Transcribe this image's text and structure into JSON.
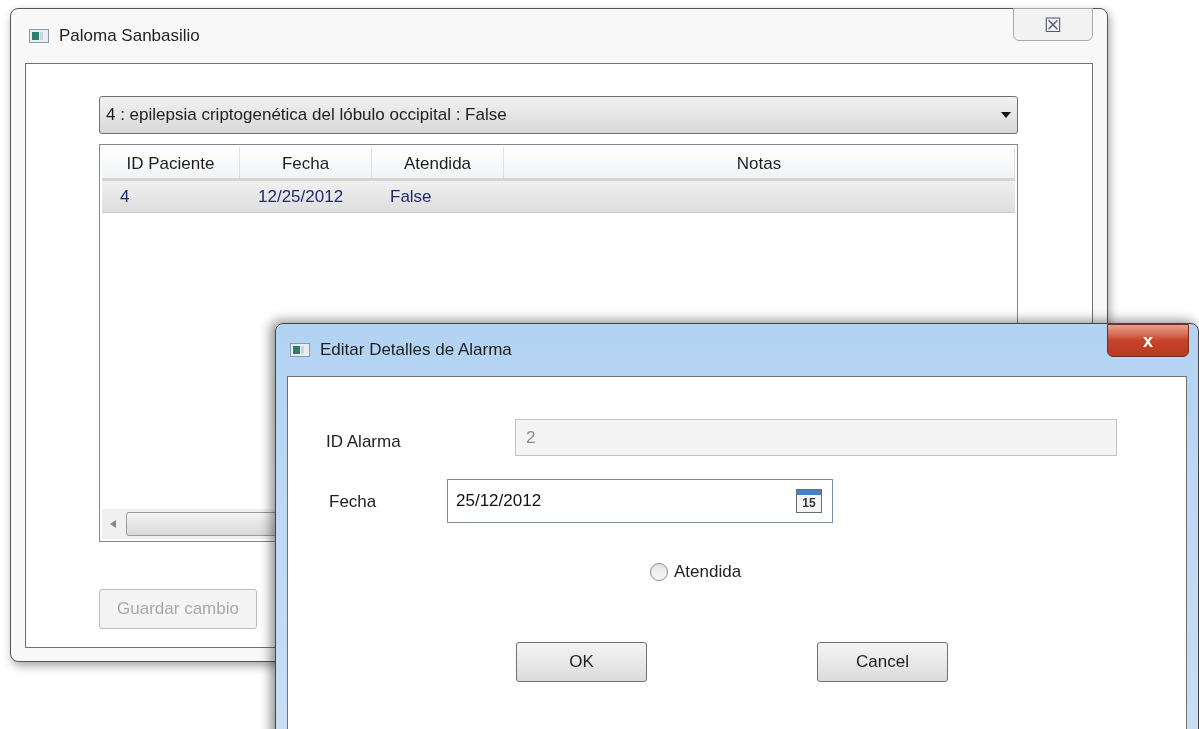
{
  "main_window": {
    "title": "Paloma Sanbasilio",
    "close_glyph": "☒",
    "combobox": {
      "value": "4 : epilepsia criptogenética del lóbulo occipital : False"
    },
    "table": {
      "columns": [
        "ID Paciente",
        "Fecha",
        "Atendida",
        "Notas"
      ],
      "rows": [
        {
          "cells": [
            "4",
            "12/25/2012",
            "False",
            ""
          ],
          "selected": true
        }
      ]
    },
    "save_button": {
      "label": "Guardar cambio",
      "disabled": true
    }
  },
  "dialog": {
    "title": "Editar Detalles de Alarma",
    "close_glyph": "x",
    "fields": [
      {
        "label": "ID Alarma",
        "value": "2",
        "disabled": true,
        "kind": "text"
      },
      {
        "label": "Fecha",
        "value": "25/12/2012",
        "disabled": false,
        "kind": "date",
        "calendar_day": "15"
      }
    ],
    "radio": {
      "label": "Atendida",
      "selected": false
    },
    "buttons": [
      "OK",
      "Cancel"
    ]
  }
}
